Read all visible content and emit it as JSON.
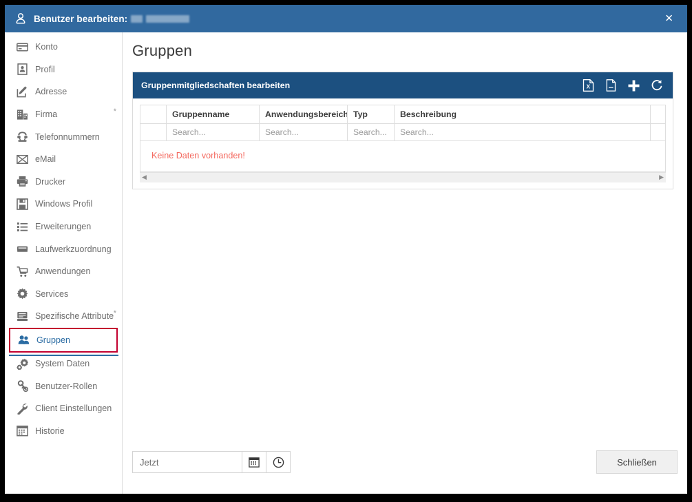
{
  "window": {
    "title_prefix": "Benutzer bearbeiten:",
    "title_redacted": true,
    "close_icon": "close-icon",
    "titlebar_color": "#31699f"
  },
  "sidebar": {
    "items": [
      {
        "label": "Konto",
        "icon": "card-icon",
        "required": false,
        "selected": false
      },
      {
        "label": "Profil",
        "icon": "id-card-icon",
        "required": false,
        "selected": false
      },
      {
        "label": "Adresse",
        "icon": "edit-square-icon",
        "required": false,
        "selected": false
      },
      {
        "label": "Firma",
        "icon": "building-icon",
        "required": true,
        "selected": false
      },
      {
        "label": "Telefonnummern",
        "icon": "telephone-icon",
        "required": false,
        "selected": false
      },
      {
        "label": "eMail",
        "icon": "envelope-icon",
        "required": false,
        "selected": false
      },
      {
        "label": "Drucker",
        "icon": "printer-icon",
        "required": false,
        "selected": false
      },
      {
        "label": "Windows Profil",
        "icon": "floppy-disk-icon",
        "required": false,
        "selected": false
      },
      {
        "label": "Erweiterungen",
        "icon": "list-icon",
        "required": false,
        "selected": false
      },
      {
        "label": "Laufwerkzuordnung",
        "icon": "drive-icon",
        "required": false,
        "selected": false
      },
      {
        "label": "Anwendungen",
        "icon": "cart-icon",
        "required": false,
        "selected": false
      },
      {
        "label": "Services",
        "icon": "gear-icon",
        "required": false,
        "selected": false
      },
      {
        "label": "Spezifische Attribute",
        "icon": "server-icon",
        "required": true,
        "selected": false
      },
      {
        "label": "Gruppen",
        "icon": "users-icon",
        "required": false,
        "selected": true
      },
      {
        "label": "System Daten",
        "icon": "gears-icon",
        "required": false,
        "selected": false
      },
      {
        "label": "Benutzer-Rollen",
        "icon": "key-user-icon",
        "required": false,
        "selected": false
      },
      {
        "label": "Client Einstellungen",
        "icon": "wrench-icon",
        "required": false,
        "selected": false
      },
      {
        "label": "Historie",
        "icon": "calendar-grid-icon",
        "required": false,
        "selected": false
      }
    ],
    "required_marker": "*",
    "selected_accent_color": "#c3002f",
    "selected_text_color": "#2b6ca3"
  },
  "main": {
    "page_title": "Gruppen",
    "panel": {
      "header_title": "Gruppenmitgliedschaften bearbeiten",
      "header_color": "#1c5080",
      "tools": [
        {
          "name": "excel-export-icon",
          "label": "Excel Export"
        },
        {
          "name": "copy-clipboard-icon",
          "label": "Kopieren"
        },
        {
          "name": "plus-icon",
          "label": "Hinzufügen"
        },
        {
          "name": "refresh-icon",
          "label": "Aktualisieren"
        }
      ],
      "grid": {
        "columns": [
          {
            "header": "",
            "filter_placeholder": ""
          },
          {
            "header": "Gruppenname",
            "filter_placeholder": "Search..."
          },
          {
            "header": "Anwendungsbereich",
            "filter_placeholder": "Search..."
          },
          {
            "header": "Typ",
            "filter_placeholder": "Search..."
          },
          {
            "header": "Beschreibung",
            "filter_placeholder": "Search..."
          },
          {
            "header": "",
            "filter_placeholder": ""
          }
        ],
        "rows": [],
        "empty_message": "Keine Daten vorhanden!",
        "empty_message_color": "#f4695f",
        "scroll_left_arrow": "◀",
        "scroll_right_arrow": "▶"
      }
    }
  },
  "footer": {
    "datetime_placeholder": "Jetzt",
    "datetime_value": "",
    "calendar_icon": "calendar-icon",
    "clock_icon": "clock-icon",
    "close_button_label": "Schließen"
  }
}
